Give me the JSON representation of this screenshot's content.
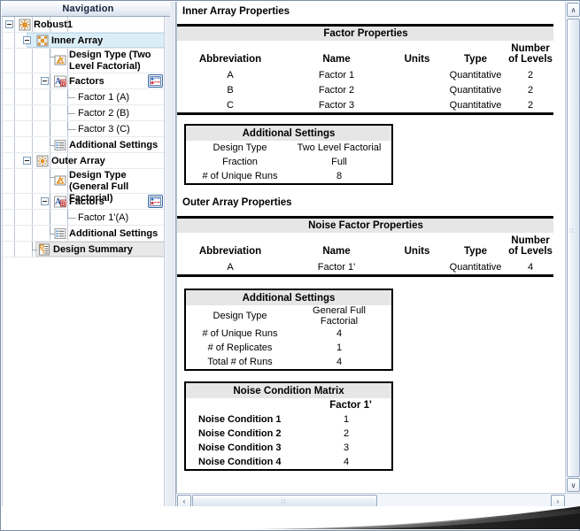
{
  "navigation": {
    "header": "Navigation",
    "tree": [
      {
        "label": "Robust1",
        "icon": "robust-design-icon",
        "bold": true,
        "expander": "collapse",
        "state": "normal"
      },
      {
        "label": "Inner Array",
        "icon": "inner-array-icon",
        "bold": true,
        "expander": "collapse",
        "state": "selected-blue"
      },
      {
        "label": "Design Type (Two Level Factorial)",
        "icon": "design-type-icon",
        "bold": true,
        "expander": "none",
        "state": "normal"
      },
      {
        "label": "Factors",
        "icon": "factors-icon",
        "bold": true,
        "expander": "collapse",
        "state": "normal",
        "button": "factors-grid-button"
      },
      {
        "label": "Factor 1 (A)",
        "icon": "none",
        "bold": false,
        "expander": "none",
        "state": "normal"
      },
      {
        "label": "Factor 2 (B)",
        "icon": "none",
        "bold": false,
        "expander": "none",
        "state": "normal"
      },
      {
        "label": "Factor 3 (C)",
        "icon": "none",
        "bold": false,
        "expander": "none",
        "state": "normal"
      },
      {
        "label": "Additional Settings",
        "icon": "settings-list-icon",
        "bold": true,
        "expander": "none",
        "state": "normal"
      },
      {
        "label": "Outer Array",
        "icon": "outer-array-icon",
        "bold": true,
        "expander": "collapse",
        "state": "normal"
      },
      {
        "label": "Design Type (General Full Factorial)",
        "icon": "design-type-icon",
        "bold": true,
        "expander": "none",
        "state": "normal"
      },
      {
        "label": "Factors",
        "icon": "factors-icon",
        "bold": true,
        "expander": "collapse",
        "state": "normal",
        "button": "factors-grid-button"
      },
      {
        "label": "Factor 1'(A)",
        "icon": "none",
        "bold": false,
        "expander": "none",
        "state": "normal"
      },
      {
        "label": "Additional Settings",
        "icon": "settings-list-icon",
        "bold": true,
        "expander": "none",
        "state": "normal"
      },
      {
        "label": "Design Summary",
        "icon": "design-summary-icon",
        "bold": true,
        "expander": "none",
        "state": "selected-gray"
      }
    ]
  },
  "main": {
    "inner_title": "Inner Array Properties",
    "outer_title": "Outer Array Properties",
    "factor_properties": {
      "title": "Factor Properties",
      "columns": [
        "Abbreviation",
        "Name",
        "Units",
        "Type",
        "Number of Levels"
      ],
      "columns_line1": [
        "Abbreviation",
        "Name",
        "Units",
        "Type",
        "Number"
      ],
      "columns_line2": [
        "",
        "",
        "",
        "",
        "of Levels"
      ],
      "rows": [
        [
          "A",
          "Factor 1",
          "",
          "Quantitative",
          "2"
        ],
        [
          "B",
          "Factor 2",
          "",
          "Quantitative",
          "2"
        ],
        [
          "C",
          "Factor 3",
          "",
          "Quantitative",
          "2"
        ]
      ]
    },
    "inner_additional_settings": {
      "title": "Additional Settings",
      "rows": [
        [
          "Design Type",
          "Two Level Factorial"
        ],
        [
          "Fraction",
          "Full"
        ],
        [
          "# of Unique Runs",
          "8"
        ]
      ]
    },
    "noise_factor_properties": {
      "title": "Noise Factor Properties",
      "columns_line1": [
        "Abbreviation",
        "Name",
        "Units",
        "Type",
        "Number"
      ],
      "columns_line2": [
        "",
        "",
        "",
        "",
        "of Levels"
      ],
      "rows": [
        [
          "A",
          "Factor 1'",
          "",
          "Quantitative",
          "4"
        ]
      ]
    },
    "outer_additional_settings": {
      "title": "Additional Settings",
      "rows": [
        [
          "Design Type",
          "General Full Factorial"
        ],
        [
          "# of Unique Runs",
          "4"
        ],
        [
          "# of Replicates",
          "1"
        ],
        [
          "Total # of Runs",
          "4"
        ]
      ]
    },
    "noise_condition_matrix": {
      "title": "Noise Condition Matrix",
      "column_header": "Factor 1'",
      "rows": [
        [
          "Noise Condition 1",
          "1"
        ],
        [
          "Noise Condition 2",
          "2"
        ],
        [
          "Noise Condition 3",
          "3"
        ],
        [
          "Noise Condition 4",
          "4"
        ]
      ]
    }
  },
  "scrollbars": {
    "vertical_up": "∧",
    "vertical_down": "∨",
    "horizontal_left": "‹",
    "horizontal_right": "›",
    "grip": "∷"
  },
  "colors": {
    "selection_blue": "#dbeef7",
    "selection_gray": "#e8e8e8",
    "table_title_gray": "#e6e6e6",
    "panel_border": "#9aa9bd"
  }
}
